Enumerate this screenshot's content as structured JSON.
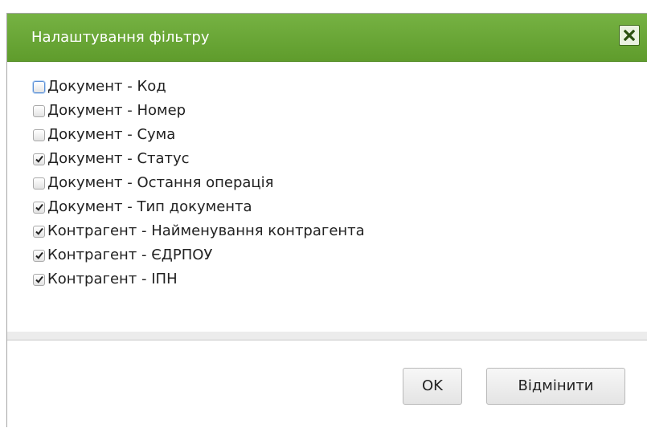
{
  "dialog": {
    "title": "Налаштування фільтру",
    "close_icon": "close-x-icon",
    "accent_color": "#6aa738"
  },
  "options": [
    {
      "label": "Документ - Код",
      "checked": false,
      "focused": true
    },
    {
      "label": "Документ - Номер",
      "checked": false,
      "focused": false
    },
    {
      "label": "Документ - Сума",
      "checked": false,
      "focused": false
    },
    {
      "label": "Документ - Статус",
      "checked": true,
      "focused": false
    },
    {
      "label": "Документ - Остання операція",
      "checked": false,
      "focused": false
    },
    {
      "label": "Документ - Тип документа",
      "checked": true,
      "focused": false
    },
    {
      "label": "Контрагент - Найменування контрагента",
      "checked": true,
      "focused": false
    },
    {
      "label": "Контрагент - ЄДРПОУ",
      "checked": true,
      "focused": false
    },
    {
      "label": "Контрагент - ІПН",
      "checked": true,
      "focused": false
    }
  ],
  "buttons": {
    "ok_label": "OK",
    "cancel_label": "Відмінити"
  }
}
